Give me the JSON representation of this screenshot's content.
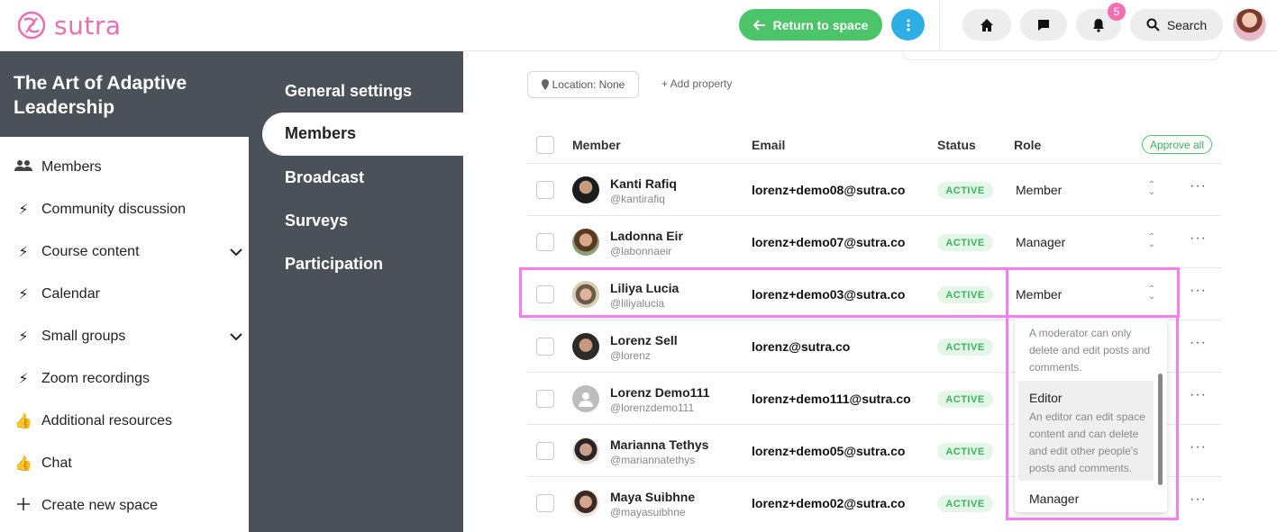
{
  "app": {
    "logo_text": "sutra",
    "brand_color": "#e96fb2"
  },
  "topbar": {
    "return_label": "Return to space",
    "notifications_count": "5",
    "search_label": "Search"
  },
  "space": {
    "title": "The Art of Adaptive Leadership"
  },
  "sidebar": {
    "items": [
      {
        "label": "Members",
        "icon": "people-icon"
      },
      {
        "label": "Community discussion",
        "icon": "lightning-icon"
      },
      {
        "label": "Course content",
        "icon": "lightning-icon",
        "expandable": true
      },
      {
        "label": "Calendar",
        "icon": "lightning-icon"
      },
      {
        "label": "Small groups",
        "icon": "lightning-icon",
        "expandable": true
      },
      {
        "label": "Zoom recordings",
        "icon": "lightning-icon"
      },
      {
        "label": "Additional resources",
        "icon": "thumbs-up-icon"
      },
      {
        "label": "Chat",
        "icon": "thumbs-up-icon"
      },
      {
        "label": "Create new space",
        "icon": "plus-icon"
      }
    ]
  },
  "settings_nav": {
    "items": [
      "General settings",
      "Members",
      "Broadcast",
      "Surveys",
      "Participation"
    ],
    "active": "Members"
  },
  "filters": {
    "location_label": "Location: None",
    "add_property_label": "+ Add property"
  },
  "table": {
    "headers": {
      "member": "Member",
      "email": "Email",
      "status": "Status",
      "role": "Role"
    },
    "approve_all_label": "Approve all",
    "rows": [
      {
        "name": "Kanti Rafiq",
        "handle": "@kantirafiq",
        "email": "lorenz+demo08@sutra.co",
        "status": "ACTIVE",
        "role": "Member"
      },
      {
        "name": "Ladonna Eir",
        "handle": "@labonnaeir",
        "email": "lorenz+demo07@sutra.co",
        "status": "ACTIVE",
        "role": "Manager"
      },
      {
        "name": "Liliya Lucia",
        "handle": "@liliyalucia",
        "email": "lorenz+demo03@sutra.co",
        "status": "ACTIVE",
        "role": "Member"
      },
      {
        "name": "Lorenz Sell",
        "handle": "@lorenz",
        "email": "lorenz@sutra.co",
        "status": "ACTIVE",
        "role": ""
      },
      {
        "name": "Lorenz Demo111",
        "handle": "@lorenzdemo111",
        "email": "lorenz+demo111@sutra.co",
        "status": "ACTIVE",
        "role": ""
      },
      {
        "name": "Marianna Tethys",
        "handle": "@mariannatethys",
        "email": "lorenz+demo05@sutra.co",
        "status": "ACTIVE",
        "role": ""
      },
      {
        "name": "Maya Suibhne",
        "handle": "@mayasuibhne",
        "email": "lorenz+demo02@sutra.co",
        "status": "ACTIVE",
        "role": ""
      }
    ]
  },
  "role_dropdown": {
    "moderator_desc": "A moderator can only delete and edit posts and comments.",
    "editor_title": "Editor",
    "editor_desc": "An editor can edit space content and can delete and edit other people's posts and comments.",
    "manager_title": "Manager"
  }
}
